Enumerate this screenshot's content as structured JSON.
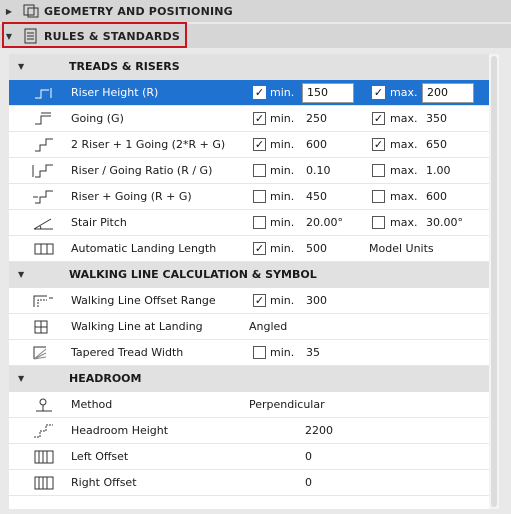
{
  "header": {
    "geometry_title": "GEOMETRY AND POSITIONING",
    "rules_title": "RULES & STANDARDS"
  },
  "sections": {
    "treads": "TREADS & RISERS",
    "walking": "WALKING LINE CALCULATION & SYMBOL",
    "headroom": "HEADROOM"
  },
  "labels": {
    "min": "min.",
    "max": "max.",
    "model_units": "Model Units"
  },
  "rows": {
    "riser_height": {
      "label": "Riser Height (R)",
      "min_checked": "✓",
      "min": "150",
      "max_checked": "✓",
      "max": "200"
    },
    "going": {
      "label": "Going (G)",
      "min_checked": "✓",
      "min": "250",
      "max_checked": "✓",
      "max": "350"
    },
    "two_riser": {
      "label": "2 Riser + 1 Going (2*R + G)",
      "min_checked": "✓",
      "min": "600",
      "max_checked": "✓",
      "max": "650"
    },
    "ratio": {
      "label": "Riser / Going Ratio (R / G)",
      "min": "0.10",
      "max": "1.00"
    },
    "riser_going": {
      "label": "Riser + Going (R + G)",
      "min": "450",
      "max": "600"
    },
    "stair_pitch": {
      "label": "Stair Pitch",
      "min": "20.00°",
      "max": "30.00°"
    },
    "landing_length": {
      "label": "Automatic Landing Length",
      "min_checked": "✓",
      "min": "500"
    },
    "wl_offset": {
      "label": "Walking Line Offset Range",
      "min_checked": "✓",
      "min": "300"
    },
    "wl_landing": {
      "label": "Walking Line at Landing",
      "value": "Angled"
    },
    "tapered": {
      "label": "Tapered Tread Width",
      "min": "35"
    },
    "method": {
      "label": "Method",
      "value": "Perpendicular"
    },
    "headroom_height": {
      "label": "Headroom Height",
      "value": "2200"
    },
    "left_offset": {
      "label": "Left Offset",
      "value": "0"
    },
    "right_offset": {
      "label": "Right Offset",
      "value": "0"
    }
  },
  "colors": {
    "selection": "#1f72d0",
    "highlight_border": "#c8141e"
  }
}
